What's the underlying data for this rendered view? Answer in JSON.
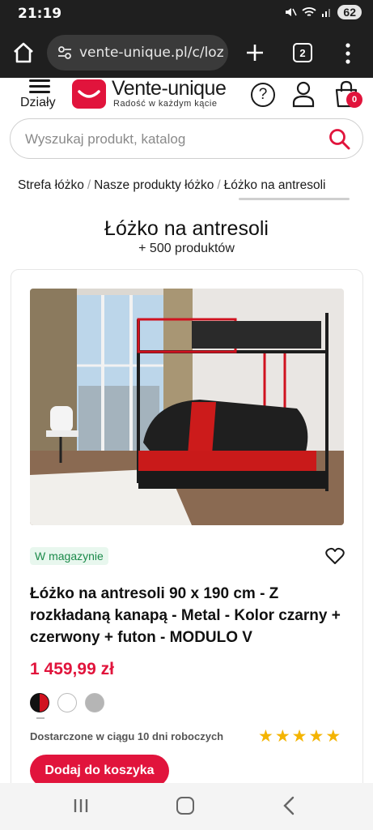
{
  "status_bar": {
    "time": "21:19",
    "battery": "62"
  },
  "browser": {
    "url": "vente-unique.pl/c/loz",
    "tab_count": "2"
  },
  "header": {
    "menu_label": "Działy",
    "brand_name": "Vente-unique",
    "tagline": "Radość w każdym kącie",
    "help_label": "?",
    "cart_count": "0"
  },
  "search": {
    "placeholder": "Wyszukaj produkt, katalog"
  },
  "breadcrumb": [
    "Strefa łóżko",
    "Nasze produkty łóżko",
    "Łóżko na antresoli"
  ],
  "page": {
    "title": "Łóżko na antresoli",
    "count": "+ 500 produktów"
  },
  "product": {
    "stock": "W magazynie",
    "name": "Łóżko na antresoli 90 x 190 cm - Z rozkładaną kanapą - Metal - Kolor czarny + czerwony + futon - MODULO V",
    "price": "1 459,99 zł",
    "swatch_colors": [
      "black-red",
      "#ffffff",
      "#b5b5b5"
    ],
    "delivery": "Dostarczone w ciągu 10 dni roboczych",
    "rating": 5,
    "rating_max": 5,
    "add_to_cart": "Dodaj do koszyka"
  },
  "colors": {
    "accent": "#e1143c",
    "stock_green": "#1b8a4a",
    "star": "#f4b400"
  }
}
